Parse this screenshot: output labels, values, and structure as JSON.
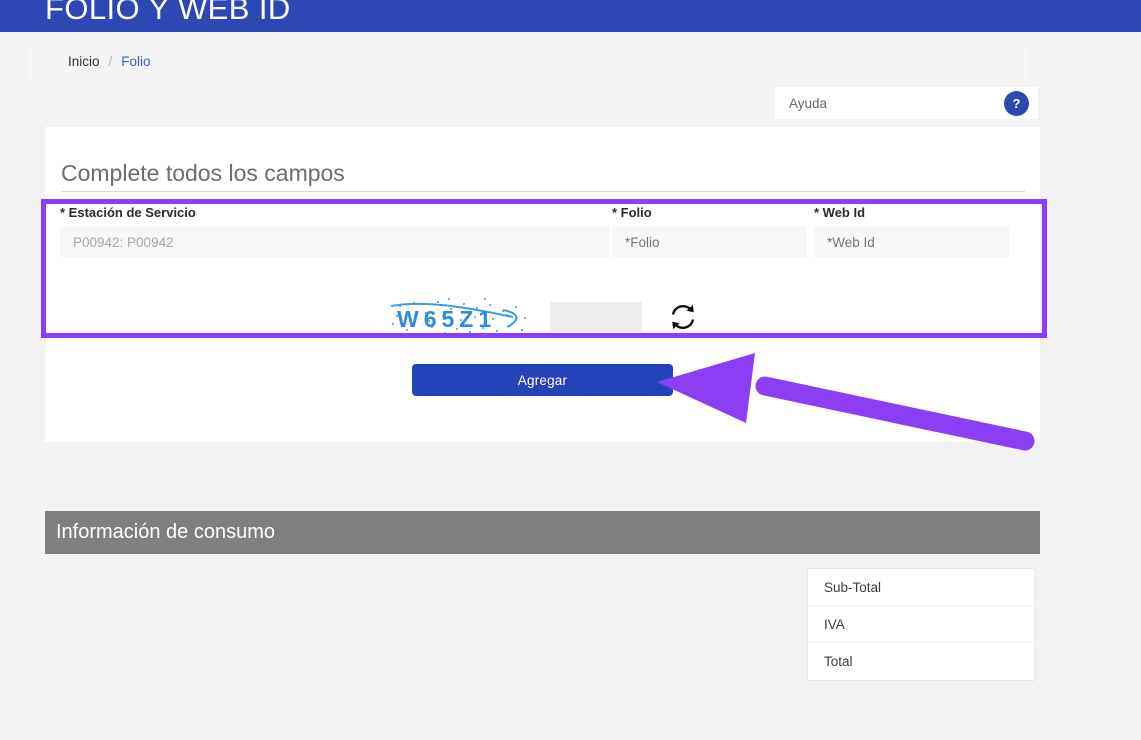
{
  "header": {
    "title": "FOLIO Y WEB ID",
    "bg_color": "#2c48b5"
  },
  "breadcrumb": {
    "home": "Inicio",
    "separator": "/",
    "current": "Folio"
  },
  "help": {
    "label": "Ayuda",
    "badge": "?",
    "badge_color": "#2b4aad"
  },
  "form": {
    "title": "Complete todos los campos",
    "fields": [
      {
        "label": "* Estación de Servicio",
        "value": "P00942: P00942",
        "placeholder": "P00942: P00942"
      },
      {
        "label": "* Folio",
        "value": "",
        "placeholder": "*Folio"
      },
      {
        "label": "* Web Id",
        "value": "",
        "placeholder": "*Web Id"
      }
    ],
    "captcha": {
      "text": "W65Z1",
      "input_value": "",
      "input_placeholder": "",
      "refresh_icon": "refresh-icon",
      "text_color": "#2d8bda"
    },
    "submit_label": "Agregar",
    "submit_color": "#2543b8"
  },
  "annotation": {
    "highlight_color": "#8b3ff5",
    "arrow_color": "#8b3ff5"
  },
  "consumo": {
    "title": "Información de consumo",
    "totals": [
      {
        "label": "Sub-Total",
        "value": ""
      },
      {
        "label": "IVA",
        "value": ""
      },
      {
        "label": "Total",
        "value": ""
      }
    ]
  }
}
